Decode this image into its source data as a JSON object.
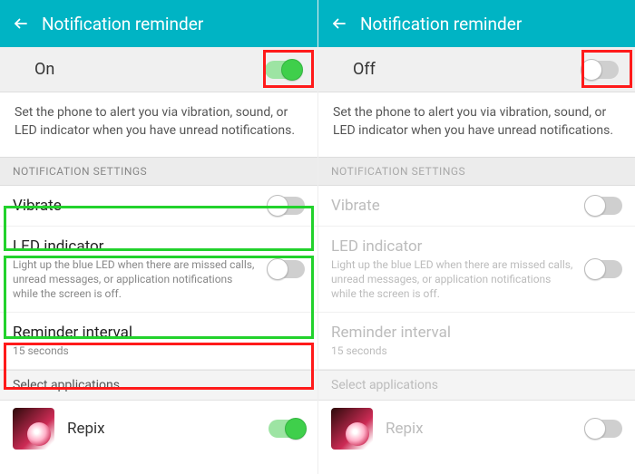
{
  "header": {
    "title": "Notification reminder"
  },
  "left": {
    "master_label": "On",
    "master_on": true,
    "description": "Set the phone to alert you via vibration, sound, or LED indicator when you have unread notifications.",
    "section_label": "NOTIFICATION SETTINGS",
    "vibrate": {
      "title": "Vibrate",
      "on": false
    },
    "led": {
      "title": "LED indicator",
      "sub": "Light up the blue LED when there are missed calls, unread messages, or application notifications while the screen is off.",
      "on": false
    },
    "interval": {
      "title": "Reminder interval",
      "sub": "15 seconds"
    },
    "select_apps_label": "Select applications",
    "app": {
      "name": "Repix",
      "on": true
    }
  },
  "right": {
    "master_label": "Off",
    "master_on": false,
    "description": "Set the phone to alert you via vibration, sound, or LED indicator when you have unread notifications.",
    "section_label": "NOTIFICATION SETTINGS",
    "vibrate": {
      "title": "Vibrate",
      "on": false
    },
    "led": {
      "title": "LED indicator",
      "sub": "Light up the blue LED when there are missed calls, unread messages, or application notifications while the screen is off.",
      "on": false
    },
    "interval": {
      "title": "Reminder interval",
      "sub": "15 seconds"
    },
    "select_apps_label": "Select applications",
    "app": {
      "name": "Repix",
      "on": false
    }
  },
  "highlights": {
    "left_master_toggle": "red",
    "right_master_toggle": "red",
    "left_vibrate_row": "green",
    "left_led_row": "green",
    "left_interval_row": "red"
  }
}
